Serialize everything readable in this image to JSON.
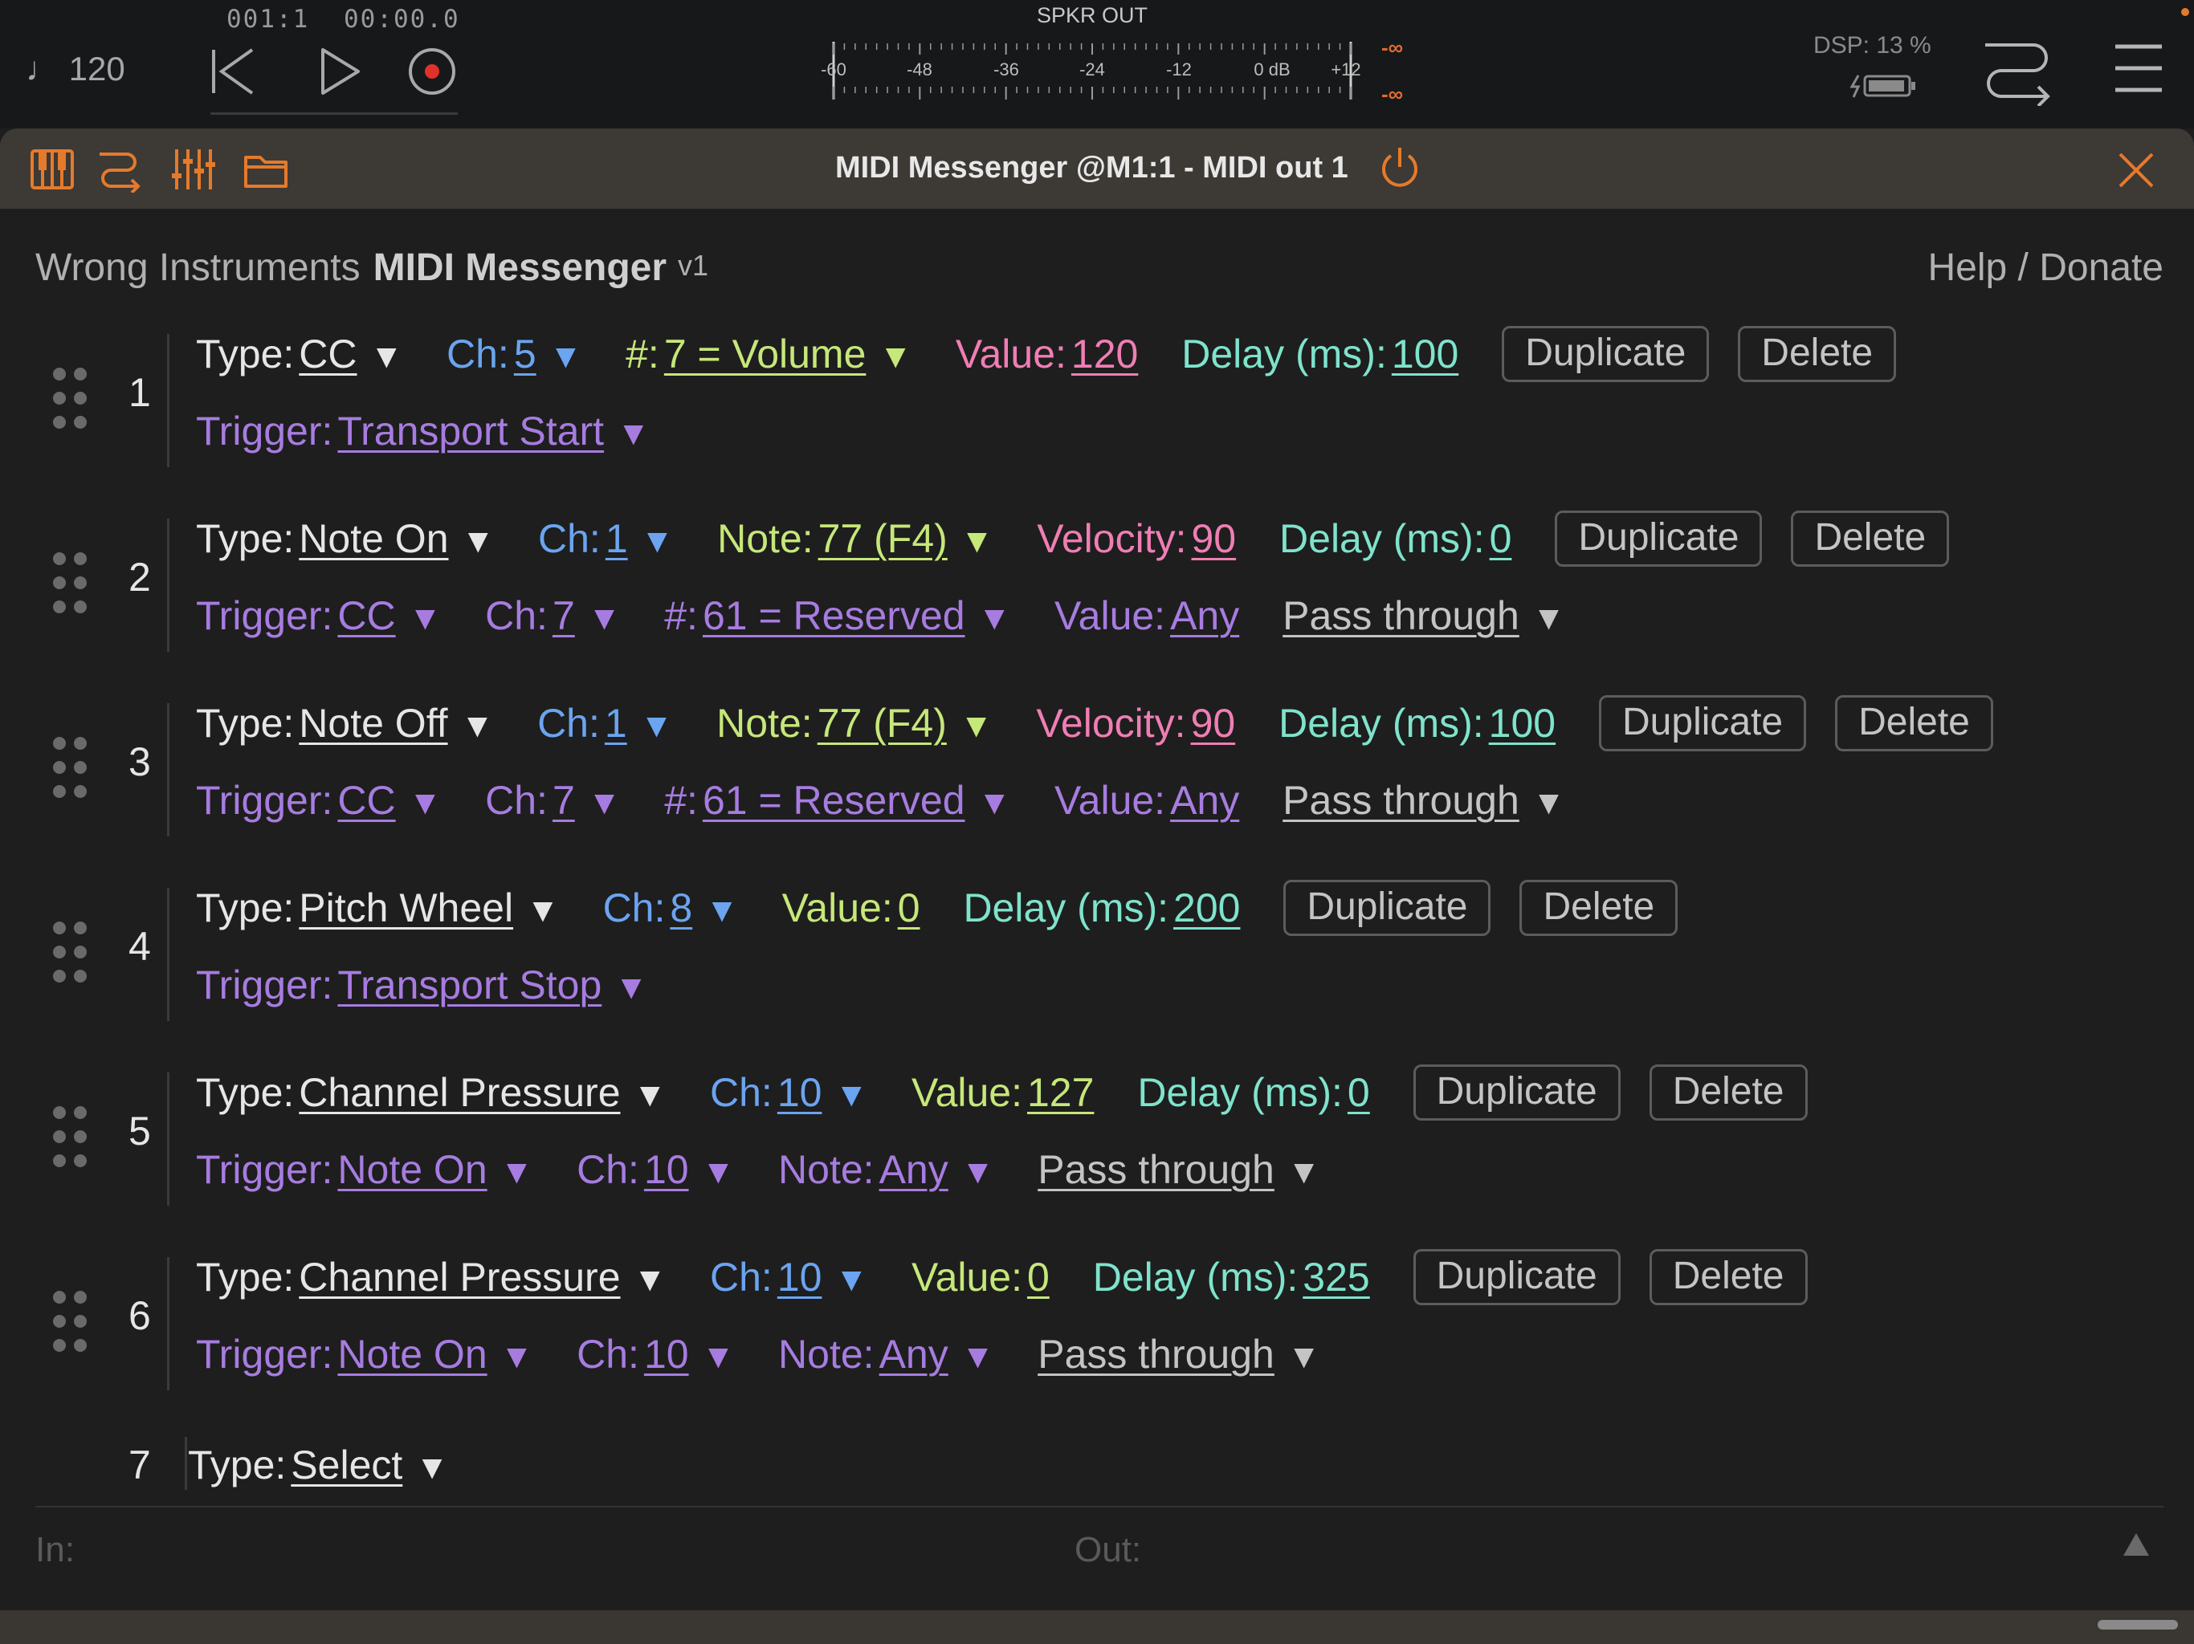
{
  "transport": {
    "tempo": "♩ 120",
    "position": "001:1 00:00.0",
    "meter_label": "SPKR OUT",
    "meter_ticks": [
      "-60",
      "-48",
      "-36",
      "-24",
      "-12",
      "0 dB",
      "+12"
    ],
    "peak_left": "-∞",
    "peak_right": "-∞",
    "dsp": "DSP: 13 %"
  },
  "plugin_bar": {
    "title": "MIDI Messenger @M1:1 - MIDI out 1"
  },
  "app": {
    "brand": "Wrong Instruments",
    "name": "MIDI Messenger",
    "version": "v1",
    "help": "Help / Donate"
  },
  "labels": {
    "type": "Type:",
    "ch": "Ch:",
    "num": "#:",
    "note": "Note:",
    "value": "Value:",
    "velocity": "Velocity:",
    "delay": "Delay (ms):",
    "trigger": "Trigger:",
    "duplicate": "Duplicate",
    "delete": "Delete",
    "arrow": "▼"
  },
  "rows": [
    {
      "index": "1",
      "type": "CC",
      "ch": "5",
      "num": "7 = Volume",
      "value": "120",
      "delay": "100",
      "trigger": "Transport Start"
    },
    {
      "index": "2",
      "type": "Note On",
      "ch": "1",
      "note": "77 (F4)",
      "velocity": "90",
      "delay": "0",
      "trigger": "CC",
      "t_ch": "7",
      "t_num": "61 = Reserved",
      "t_value": "Any",
      "pass": "Pass through"
    },
    {
      "index": "3",
      "type": "Note Off",
      "ch": "1",
      "note": "77 (F4)",
      "velocity": "90",
      "delay": "100",
      "trigger": "CC",
      "t_ch": "7",
      "t_num": "61 = Reserved",
      "t_value": "Any",
      "pass": "Pass through"
    },
    {
      "index": "4",
      "type": "Pitch Wheel",
      "ch": "8",
      "value": "0",
      "delay": "200",
      "trigger": "Transport Stop"
    },
    {
      "index": "5",
      "type": "Channel Pressure",
      "ch": "10",
      "value": "127",
      "delay": "0",
      "trigger": "Note On",
      "t_ch": "10",
      "t_note": "Any",
      "pass": "Pass through"
    },
    {
      "index": "6",
      "type": "Channel Pressure",
      "ch": "10",
      "value": "0",
      "delay": "325",
      "trigger": "Note On",
      "t_ch": "10",
      "t_note": "Any",
      "pass": "Pass through"
    },
    {
      "index": "7",
      "type": "Select"
    }
  ],
  "status": {
    "in": "In:",
    "out": "Out:"
  },
  "colors": {
    "type": "#e6e6e6",
    "channel": "#6ba4f0",
    "number": "#c6e77a",
    "velocity": "#ef7eb4",
    "delay": "#7fe3cc",
    "trigger": "#a77ce0",
    "accent": "#e57a2b"
  }
}
